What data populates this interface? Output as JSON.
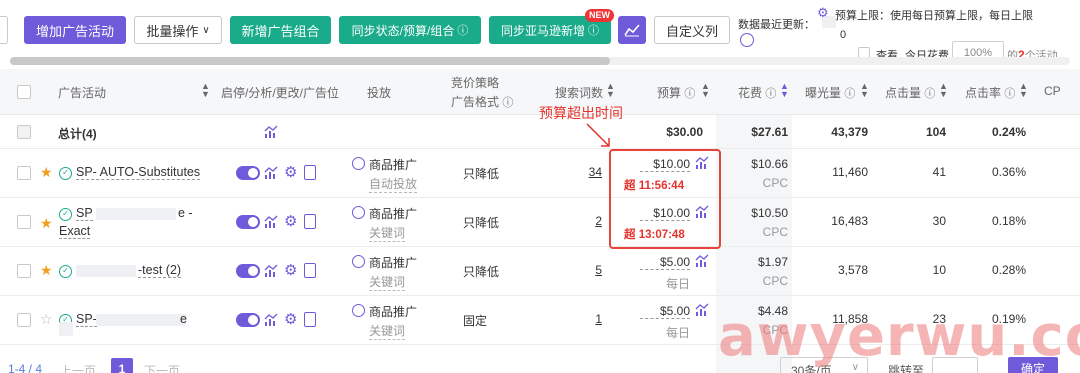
{
  "toolbar": {
    "add_campaign": "增加广告活动",
    "bulk_ops": "批量操作",
    "new_group": "新增广告组合",
    "sync_status": "同步状态/预算/组合",
    "sync_amazon": "同步亚马逊新增",
    "new_badge": "NEW",
    "custom_cols": "自定义列",
    "data_updated_label": "数据最近更新：",
    "data_updated_value": "0",
    "budget_limit": "预算上限：使用每日预算上限，每日上限",
    "view_label": "查看",
    "today_spend_label": "今日花费",
    "today_spend_value": "100%",
    "of_label": "的",
    "count_highlight": "2",
    "count_suffix": "个活动"
  },
  "headers": {
    "campaign": "广告活动",
    "actions": "启停/分析/更改/广告位",
    "placement": "投放",
    "bid_strategy": "竞价策略",
    "ad_format": "广告格式",
    "search_terms": "搜索词数",
    "budget": "预算",
    "spend": "花费",
    "impressions": "曝光量",
    "clicks": "点击量",
    "ctr": "点击率",
    "cpc": "CP"
  },
  "annotation": "预算超出时间",
  "total": {
    "label": "总计(4)",
    "budget": "$30.00",
    "spend": "$27.61",
    "impressions": "43,379",
    "clicks": "104",
    "ctr": "0.24%"
  },
  "rows": [
    {
      "name": "SP- AUTO-Substitutes",
      "name2": "",
      "ad_type": "商品推广",
      "targeting": "自动投放",
      "bid": "只降低",
      "terms": "34",
      "budget": "$10.00",
      "budget_note": "超 11:56:44",
      "spend": "$10.66",
      "spend_sub": "CPC",
      "impressions": "11,460",
      "clicks": "41",
      "ctr": "0.36%",
      "starred": true
    },
    {
      "name": "SP",
      "name_tail": "e -",
      "name2": "Exact",
      "ad_type": "商品推广",
      "targeting": "关键词",
      "bid": "只降低",
      "terms": "2",
      "budget": "$10.00",
      "budget_note": "超 13:07:48",
      "spend": "$10.50",
      "spend_sub": "CPC",
      "impressions": "16,483",
      "clicks": "30",
      "ctr": "0.18%",
      "starred": true
    },
    {
      "name": "-test (2)",
      "name2": "",
      "ad_type": "商品推广",
      "targeting": "关键词",
      "bid": "只降低",
      "terms": "5",
      "budget": "$5.00",
      "budget_note": "每日",
      "spend": "$1.97",
      "spend_sub": "CPC",
      "impressions": "3,578",
      "clicks": "10",
      "ctr": "0.28%",
      "starred": true
    },
    {
      "name": "SP-",
      "name_tail": "e",
      "name2": "",
      "ad_type": "商品推广",
      "targeting": "关键词",
      "bid": "固定",
      "terms": "1",
      "budget": "$5.00",
      "budget_note": "每日",
      "spend": "$4.48",
      "spend_sub": "CPC",
      "impressions": "11,858",
      "clicks": "23",
      "ctr": "0.19%",
      "starred": false
    }
  ],
  "pagination": {
    "range": "1-4 / 4",
    "prev": "上一页",
    "page": "1",
    "next": "下一页",
    "per_page": "30条/页",
    "goto": "跳转至",
    "confirm": "确定"
  },
  "watermark": "awyerwu.com",
  "colors": {
    "accent": "#6f5bd9",
    "green": "#1aab8a",
    "red": "#e5342d"
  }
}
